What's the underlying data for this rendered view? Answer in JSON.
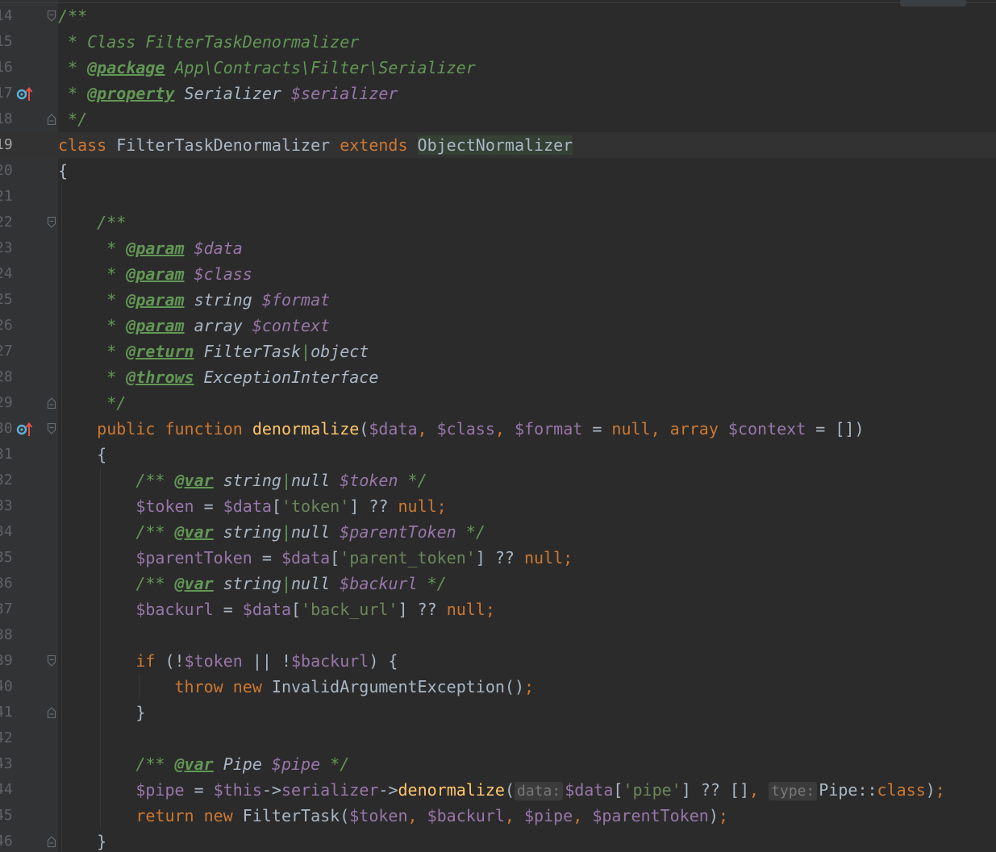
{
  "editor": {
    "language": "PHP",
    "rows": [
      {
        "line": "14",
        "fold": "open",
        "tokens": [
          [
            "cm",
            "/**"
          ]
        ]
      },
      {
        "line": "15",
        "tokens": [
          [
            "cm",
            " * Class FilterTaskDenormalizer"
          ]
        ]
      },
      {
        "line": "16",
        "tokens": [
          [
            "cm",
            " * "
          ],
          [
            "tag",
            "@package"
          ],
          [
            "cm",
            " App\\Contracts\\Filter\\Serializer"
          ]
        ]
      },
      {
        "line": "17",
        "marker": "override",
        "tokens": [
          [
            "cm",
            " * "
          ],
          [
            "tag",
            "@property"
          ],
          [
            "ty",
            " Serializer "
          ],
          [
            "pv",
            "$serializer"
          ]
        ]
      },
      {
        "line": "18",
        "fold": "close",
        "tokens": [
          [
            "cm",
            " */"
          ]
        ]
      },
      {
        "line": "19",
        "current": true,
        "tokens": [
          [
            "kw",
            "class"
          ],
          [
            "tx",
            " FilterTaskDenormalizer "
          ],
          [
            "kw",
            "extends"
          ],
          [
            "tx",
            " "
          ],
          [
            "hl",
            "ObjectNormalizer"
          ]
        ]
      },
      {
        "line": "20",
        "tokens": [
          [
            "tx",
            "{"
          ]
        ]
      },
      {
        "line": "21",
        "tokens": []
      },
      {
        "line": "22",
        "fold": "open",
        "tokens": [
          [
            "tx",
            "    "
          ],
          [
            "cm",
            "/**"
          ]
        ]
      },
      {
        "line": "23",
        "tokens": [
          [
            "tx",
            "    "
          ],
          [
            "cm",
            " * "
          ],
          [
            "tag",
            "@param"
          ],
          [
            "cm",
            " "
          ],
          [
            "pv",
            "$data"
          ]
        ]
      },
      {
        "line": "24",
        "tokens": [
          [
            "tx",
            "    "
          ],
          [
            "cm",
            " * "
          ],
          [
            "tag",
            "@param"
          ],
          [
            "cm",
            " "
          ],
          [
            "pv",
            "$class"
          ]
        ]
      },
      {
        "line": "25",
        "tokens": [
          [
            "tx",
            "    "
          ],
          [
            "cm",
            " * "
          ],
          [
            "tag",
            "@param"
          ],
          [
            "ty",
            " string "
          ],
          [
            "pv",
            "$format"
          ]
        ]
      },
      {
        "line": "26",
        "tokens": [
          [
            "tx",
            "    "
          ],
          [
            "cm",
            " * "
          ],
          [
            "tag",
            "@param"
          ],
          [
            "ty",
            " array "
          ],
          [
            "pv",
            "$context"
          ]
        ]
      },
      {
        "line": "27",
        "tokens": [
          [
            "tx",
            "    "
          ],
          [
            "cm",
            " * "
          ],
          [
            "tag",
            "@return"
          ],
          [
            "ty",
            " FilterTask"
          ],
          [
            "sep",
            "|"
          ],
          [
            "ty",
            "object"
          ]
        ]
      },
      {
        "line": "28",
        "tokens": [
          [
            "tx",
            "    "
          ],
          [
            "cm",
            " * "
          ],
          [
            "tag",
            "@throws"
          ],
          [
            "ty",
            " ExceptionInterface"
          ]
        ]
      },
      {
        "line": "29",
        "fold": "close",
        "tokens": [
          [
            "tx",
            "    "
          ],
          [
            "cm",
            " */"
          ]
        ]
      },
      {
        "line": "30",
        "marker": "override",
        "fold": "open",
        "tokens": [
          [
            "tx",
            "    "
          ],
          [
            "kw",
            "public function "
          ],
          [
            "fn",
            "denormalize"
          ],
          [
            "tx",
            "("
          ],
          [
            "var",
            "$data"
          ],
          [
            "kw",
            ", "
          ],
          [
            "var",
            "$class"
          ],
          [
            "kw",
            ", "
          ],
          [
            "var",
            "$format"
          ],
          [
            "tx",
            " = "
          ],
          [
            "kw",
            "null, array "
          ],
          [
            "var",
            "$context"
          ],
          [
            "tx",
            " = [])"
          ]
        ]
      },
      {
        "line": "31",
        "tokens": [
          [
            "tx",
            "    {"
          ]
        ]
      },
      {
        "line": "32",
        "tokens": [
          [
            "tx",
            "        "
          ],
          [
            "cm",
            "/** "
          ],
          [
            "tag",
            "@var"
          ],
          [
            "ty",
            " string"
          ],
          [
            "sep",
            "|"
          ],
          [
            "ty",
            "null "
          ],
          [
            "pv",
            "$token"
          ],
          [
            "cm",
            " */"
          ]
        ]
      },
      {
        "line": "33",
        "tokens": [
          [
            "tx",
            "        "
          ],
          [
            "var",
            "$token"
          ],
          [
            "tx",
            " = "
          ],
          [
            "var",
            "$data"
          ],
          [
            "tx",
            "["
          ],
          [
            "str",
            "'token'"
          ],
          [
            "tx",
            "] ?? "
          ],
          [
            "kw",
            "null;"
          ]
        ]
      },
      {
        "line": "34",
        "tokens": [
          [
            "tx",
            "        "
          ],
          [
            "cm",
            "/** "
          ],
          [
            "tag",
            "@var"
          ],
          [
            "ty",
            " string"
          ],
          [
            "sep",
            "|"
          ],
          [
            "ty",
            "null "
          ],
          [
            "pv",
            "$parentToken"
          ],
          [
            "cm",
            " */"
          ]
        ]
      },
      {
        "line": "35",
        "tokens": [
          [
            "tx",
            "        "
          ],
          [
            "var",
            "$parentToken"
          ],
          [
            "tx",
            " = "
          ],
          [
            "var",
            "$data"
          ],
          [
            "tx",
            "["
          ],
          [
            "str",
            "'parent_token'"
          ],
          [
            "tx",
            "] ?? "
          ],
          [
            "kw",
            "null;"
          ]
        ]
      },
      {
        "line": "36",
        "tokens": [
          [
            "tx",
            "        "
          ],
          [
            "cm",
            "/** "
          ],
          [
            "tag",
            "@var"
          ],
          [
            "ty",
            " string"
          ],
          [
            "sep",
            "|"
          ],
          [
            "ty",
            "null "
          ],
          [
            "pv",
            "$backurl"
          ],
          [
            "cm",
            " */"
          ]
        ]
      },
      {
        "line": "37",
        "tokens": [
          [
            "tx",
            "        "
          ],
          [
            "var",
            "$backurl"
          ],
          [
            "tx",
            " = "
          ],
          [
            "var",
            "$data"
          ],
          [
            "tx",
            "["
          ],
          [
            "str",
            "'back_url'"
          ],
          [
            "tx",
            "] ?? "
          ],
          [
            "kw",
            "null;"
          ]
        ]
      },
      {
        "line": "38",
        "tokens": []
      },
      {
        "line": "39",
        "fold": "open",
        "tokens": [
          [
            "tx",
            "        "
          ],
          [
            "kw",
            "if"
          ],
          [
            "tx",
            " (!"
          ],
          [
            "var",
            "$token"
          ],
          [
            "tx",
            " || !"
          ],
          [
            "var",
            "$backurl"
          ],
          [
            "tx",
            ") {"
          ]
        ]
      },
      {
        "line": "40",
        "tokens": [
          [
            "tx",
            "            "
          ],
          [
            "kw",
            "throw new "
          ],
          [
            "tx",
            "InvalidArgumentException()"
          ],
          [
            "kw",
            ";"
          ]
        ]
      },
      {
        "line": "41",
        "fold": "close",
        "tokens": [
          [
            "tx",
            "        }"
          ]
        ]
      },
      {
        "line": "42",
        "tokens": []
      },
      {
        "line": "43",
        "tokens": [
          [
            "tx",
            "        "
          ],
          [
            "cm",
            "/** "
          ],
          [
            "tag",
            "@var"
          ],
          [
            "ty",
            " Pipe "
          ],
          [
            "pv",
            "$pipe"
          ],
          [
            "cm",
            " */"
          ]
        ]
      },
      {
        "line": "44",
        "tokens": [
          [
            "tx",
            "        "
          ],
          [
            "var",
            "$pipe"
          ],
          [
            "tx",
            " = "
          ],
          [
            "var",
            "$this"
          ],
          [
            "tx",
            "->"
          ],
          [
            "var",
            "serializer"
          ],
          [
            "tx",
            "->"
          ],
          [
            "fn",
            "denormalize"
          ],
          [
            "tx",
            "("
          ],
          [
            "hint",
            "data:"
          ],
          [
            "var",
            "$data"
          ],
          [
            "tx",
            "["
          ],
          [
            "str",
            "'pipe'"
          ],
          [
            "tx",
            "] ?? []"
          ],
          [
            "kw",
            ", "
          ],
          [
            "hint",
            "type:"
          ],
          [
            "tx",
            "Pipe::"
          ],
          [
            "kw",
            "class"
          ],
          [
            "tx",
            ")"
          ],
          [
            "kw",
            ";"
          ]
        ]
      },
      {
        "line": "45",
        "tokens": [
          [
            "tx",
            "        "
          ],
          [
            "kw",
            "return new "
          ],
          [
            "tx",
            "FilterTask("
          ],
          [
            "var",
            "$token"
          ],
          [
            "kw",
            ", "
          ],
          [
            "var",
            "$backurl"
          ],
          [
            "kw",
            ", "
          ],
          [
            "var",
            "$pipe"
          ],
          [
            "kw",
            ", "
          ],
          [
            "var",
            "$parentToken"
          ],
          [
            "tx",
            ")"
          ],
          [
            "kw",
            ";"
          ]
        ]
      },
      {
        "line": "46",
        "fold": "close",
        "tokens": [
          [
            "tx",
            "    }"
          ]
        ]
      }
    ]
  }
}
